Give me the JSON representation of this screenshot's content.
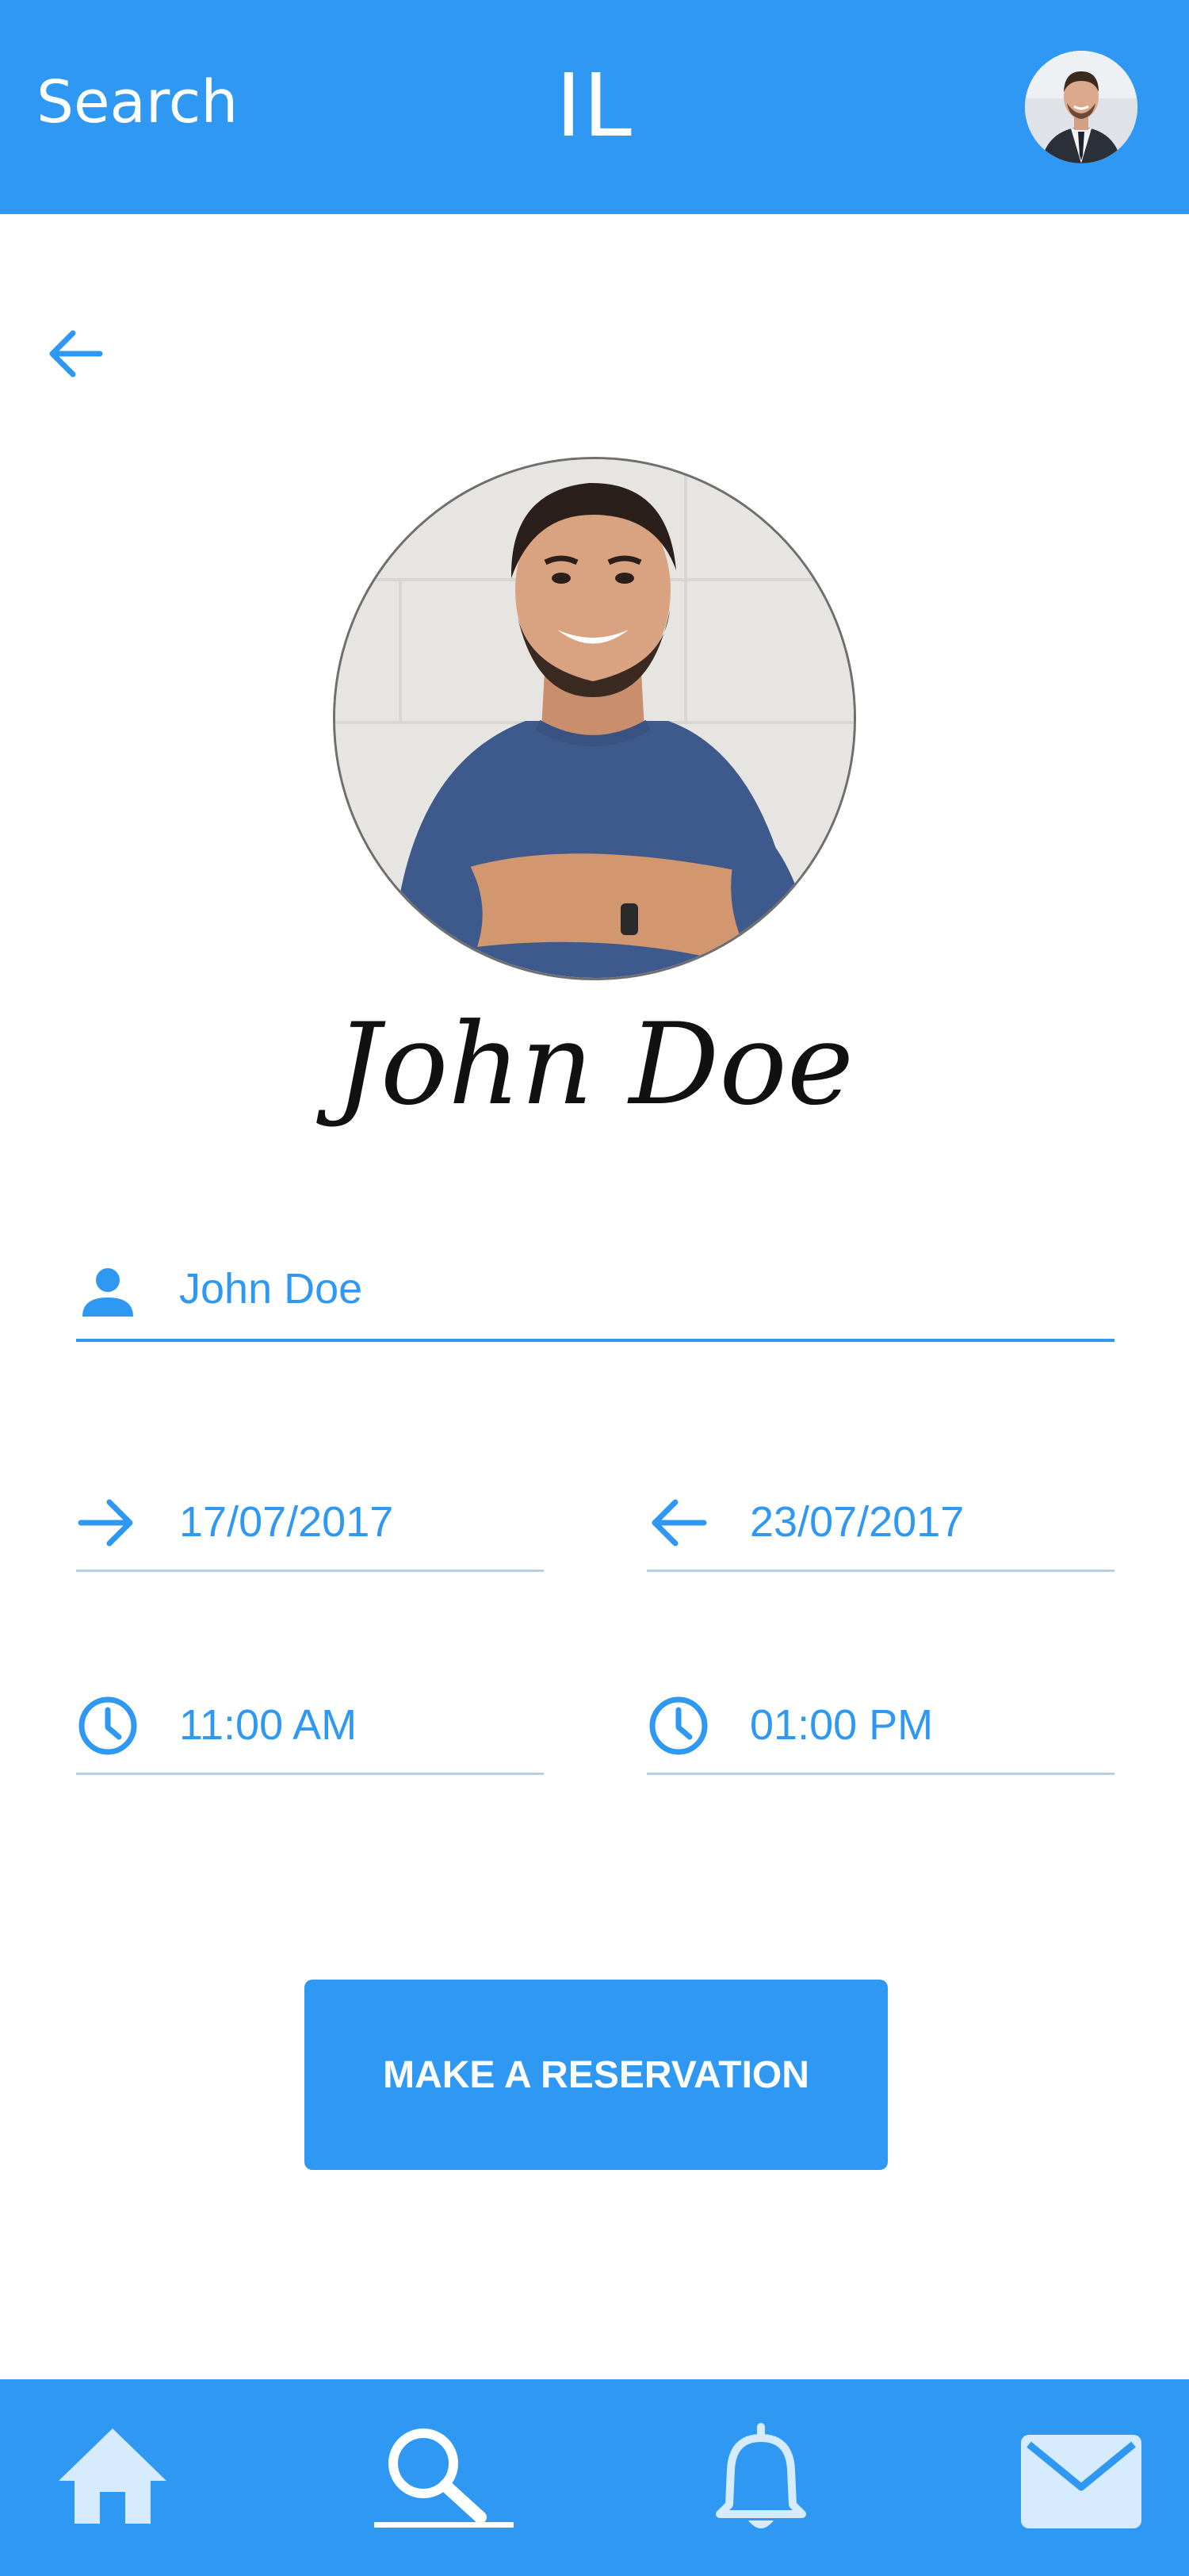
{
  "header": {
    "search_label": "Search",
    "logo_text": "IL"
  },
  "profile": {
    "name": "John Doe"
  },
  "form": {
    "guest_name": "John Doe",
    "check_in_date": "17/07/2017",
    "check_out_date": "23/07/2017",
    "check_in_time": "11:00 AM",
    "check_out_time": "01:00 PM"
  },
  "actions": {
    "reserve_label": "MAKE A RESERVATION"
  },
  "bottom_nav": {
    "items": [
      "home",
      "search",
      "notifications",
      "messages"
    ],
    "active": "search"
  },
  "icons": {
    "back": "arrow-left-icon",
    "person": "person-icon",
    "check_in": "arrow-right-icon",
    "check_out": "arrow-left-icon",
    "time": "clock-icon",
    "home": "home-icon",
    "search": "search-icon",
    "bell": "bell-icon",
    "mail": "mail-icon"
  },
  "colors": {
    "primary": "#2f98f3",
    "nav_icon": "#d6ebfd",
    "underline_light": "#a8d1f8"
  }
}
